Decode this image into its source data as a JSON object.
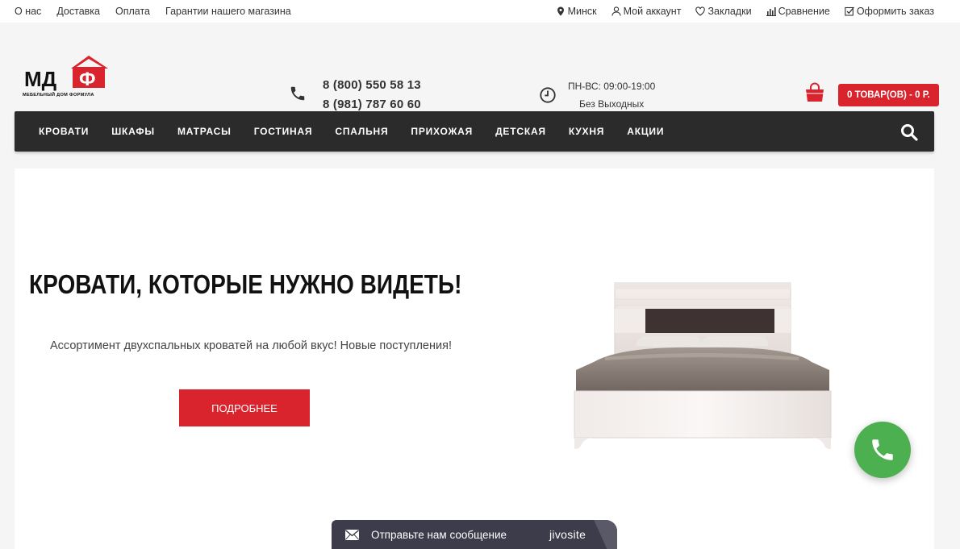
{
  "topbar": {
    "links": [
      "О нас",
      "Доставка",
      "Оплата",
      "Гарантии нашего магазина"
    ],
    "city": "Минск",
    "account": "Мой аккаунт",
    "bookmarks": "Закладки",
    "compare": "Сравнение",
    "checkout": "Оформить заказ"
  },
  "logo": {
    "text": "МДФ",
    "tagline": "МЕБЕЛЬНЫЙ ДОМ ФОРМУЛА"
  },
  "contacts": {
    "phone1": "8 (800) 550 58 13",
    "phone2": "8 (981) 787 60 60"
  },
  "hours": {
    "line1": "ПН-ВС: 09:00-19:00",
    "line2": "Без Выходных"
  },
  "cart": {
    "label": "0 ТОВАР(ОВ) - 0 Р."
  },
  "nav": {
    "items": [
      "КРОВАТИ",
      "ШКАФЫ",
      "МАТРАСЫ",
      "ГОСТИНАЯ",
      "СПАЛЬНЯ",
      "ПРИХОЖАЯ",
      "ДЕТСКАЯ",
      "КУХНЯ",
      "АКЦИИ"
    ]
  },
  "hero": {
    "title": "КРОВАТИ, КОТОРЫЕ НУЖНО ВИДЕТЬ!",
    "subtitle": "Ассортимент двухспальных кроватей на любой вкус! Новые поступления!",
    "button": "ПОДРОБНЕЕ"
  },
  "chat": {
    "message": "Отправьте нам сообщение",
    "brand": "jivosite"
  },
  "colors": {
    "accent": "#d9232d",
    "nav_bg": "#2b2b2b",
    "call_green": "#4caf50",
    "chat_bg": "#3d3c4b"
  }
}
